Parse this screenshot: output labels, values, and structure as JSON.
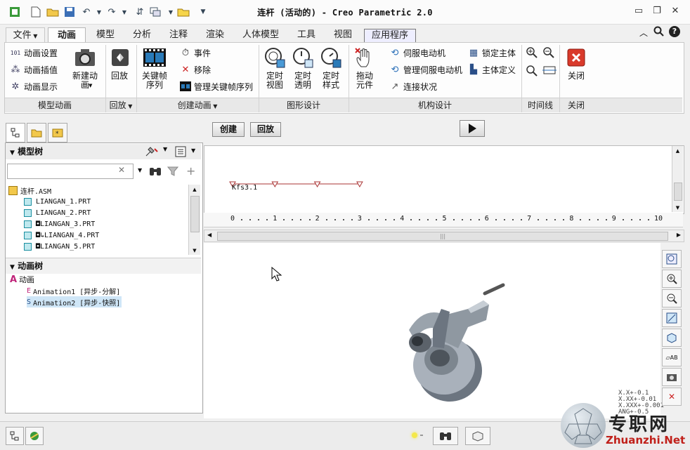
{
  "window": {
    "title": "连杆 (活动的) - Creo Parametric 2.0"
  },
  "tabs": [
    {
      "label": "文件",
      "has_dropdown": true
    },
    {
      "label": "动画",
      "active": true
    },
    {
      "label": "模型"
    },
    {
      "label": "分析"
    },
    {
      "label": "注释"
    },
    {
      "label": "渲染"
    },
    {
      "label": "人体模型"
    },
    {
      "label": "工具"
    },
    {
      "label": "视图"
    },
    {
      "label": "应用程序",
      "boxed": true
    }
  ],
  "ribbon": {
    "model_animation": {
      "group_label": "模型动画",
      "items": [
        "动画设置",
        "动画插值",
        "动画显示"
      ],
      "new_animation": "新建动\n画"
    },
    "playback": {
      "group_label": "回放",
      "button": "回放"
    },
    "create_animation": {
      "group_label": "创建动画",
      "keyframe_seq": "关键帧\n序列",
      "items": [
        "事件",
        "移除",
        "管理关键帧序列"
      ]
    },
    "graphic_design": {
      "group_label": "图形设计",
      "buttons": [
        "定时\n视图",
        "定时\n透明",
        "定时\n样式"
      ]
    },
    "mechanism_design": {
      "group_label": "机构设计",
      "drag": "拖动\n元件",
      "col1": [
        "伺服电动机",
        "管理伺服电动机",
        "连接状况"
      ],
      "col2": [
        "锁定主体",
        "主体定义"
      ]
    },
    "timeline": {
      "group_label": "时间线"
    },
    "close": {
      "group_label": "关闭",
      "button": "关闭"
    }
  },
  "toolbar2": {
    "create": "创建",
    "playback": "回放"
  },
  "model_tree": {
    "header": "模型树",
    "search_value": "",
    "root": "连杆.ASM",
    "parts": [
      "LIANGAN_1.PRT",
      "LIANGAN_2.PRT",
      "◘LIANGAN_3.PRT",
      "◘↳LIANGAN_4.PRT",
      "◘LIANGAN_5.PRT"
    ]
  },
  "anim_tree": {
    "header": "动画树",
    "root": "动画",
    "items": [
      "Animation1 [异步-分解]",
      "Animation2 [异步-快照]"
    ],
    "selected_index": 1
  },
  "timeline": {
    "keyframe_label": "Kfs3.1",
    "keyframes": [
      0,
      1,
      2,
      3
    ],
    "ticks": [
      "0",
      "1",
      "2",
      "3",
      "4",
      "5",
      "6",
      "7",
      "8",
      "9",
      "10"
    ],
    "scroll_max": 10
  },
  "graphics": {
    "tolerance_lines": [
      "X.X+-0.1",
      "X.XX+-0.01",
      "X.XXX+-0.001",
      "ANG+-0.5"
    ]
  },
  "watermark": {
    "cn": "专职网",
    "en": "Zhuanzhi.Net"
  },
  "colors": {
    "accent_red": "#cc2222",
    "tree_highlight": "#cfe6f7",
    "keyframe_line": "#aa3333"
  }
}
